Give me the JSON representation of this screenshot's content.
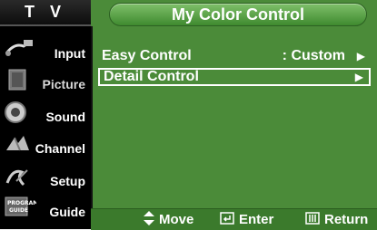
{
  "sidebar": {
    "header": "T V",
    "items": [
      {
        "label": "Input",
        "icon": "input-cable-icon"
      },
      {
        "label": "Picture",
        "icon": "picture-icon"
      },
      {
        "label": "Sound",
        "icon": "speaker-icon"
      },
      {
        "label": "Channel",
        "icon": "channel-icon"
      },
      {
        "label": "Setup",
        "icon": "setup-icon"
      },
      {
        "label": "Guide",
        "icon": "guide-icon"
      }
    ]
  },
  "panel": {
    "title": "My Color Control",
    "rows": [
      {
        "label": "Easy Control",
        "value": ": Custom",
        "arrow": "▶"
      },
      {
        "label": "Detail Control",
        "value": "",
        "arrow": "▶"
      }
    ]
  },
  "footer": {
    "move": "Move",
    "enter": "Enter",
    "return": "Return"
  },
  "colors": {
    "panel_bg": "#4b8b39",
    "title_pill": "#5ea84a",
    "sidebar_bg": "#000000"
  }
}
